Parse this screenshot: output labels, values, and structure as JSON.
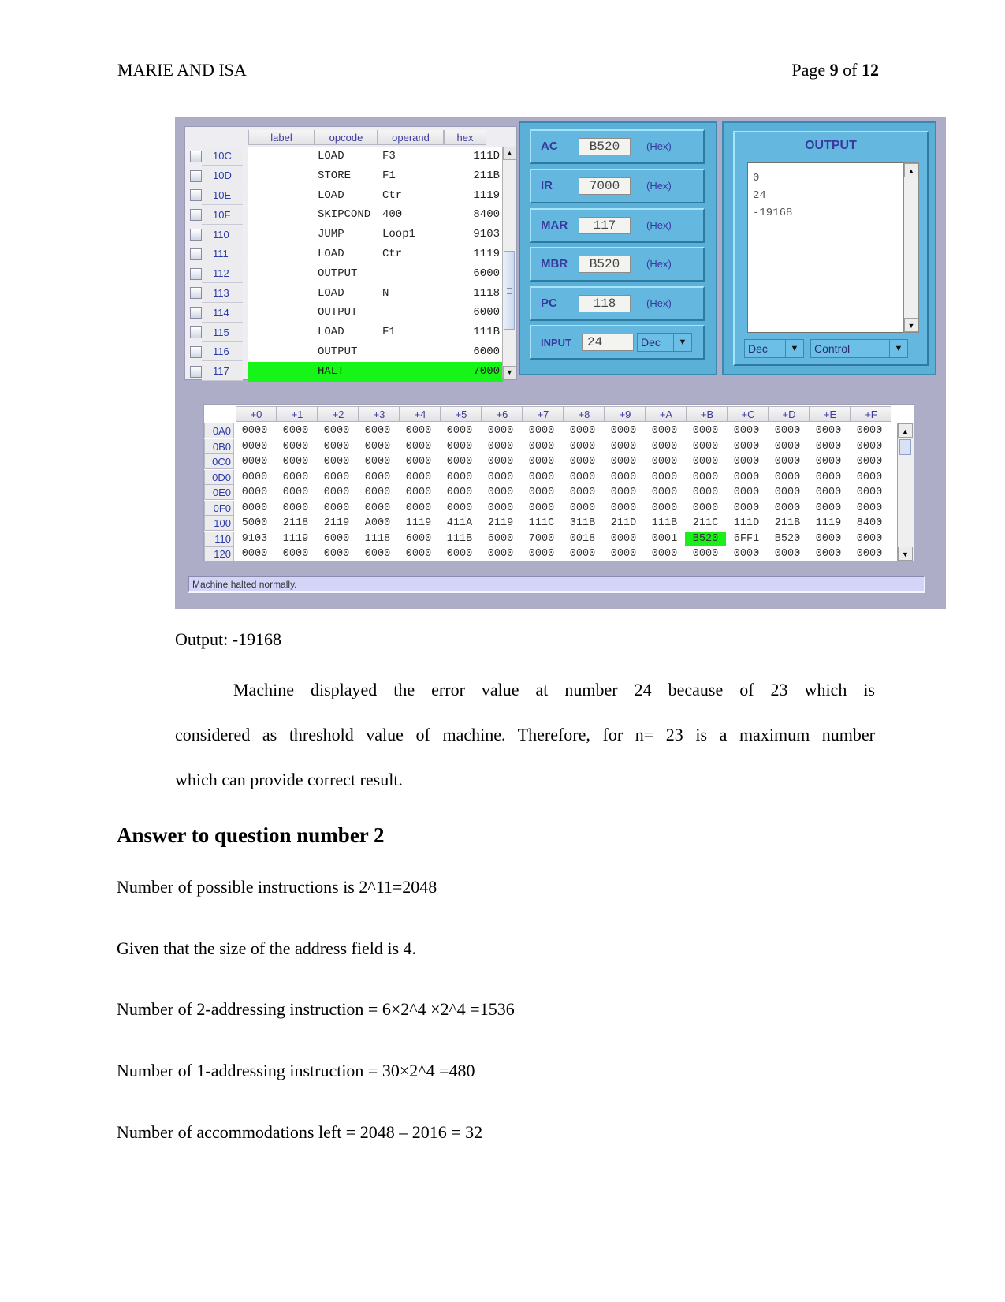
{
  "header": {
    "running_title": "MARIE AND ISA",
    "page_prefix": "Page",
    "page_number": "9",
    "page_of": "of",
    "page_total": "12"
  },
  "simulator": {
    "program_table": {
      "columns": [
        "label",
        "opcode",
        "operand",
        "hex"
      ],
      "rows": [
        {
          "addr": "10C",
          "label": "",
          "opcode": "LOAD",
          "operand": "F3",
          "hex": "111D",
          "current": false
        },
        {
          "addr": "10D",
          "label": "",
          "opcode": "STORE",
          "operand": "F1",
          "hex": "211B",
          "current": false
        },
        {
          "addr": "10E",
          "label": "",
          "opcode": "LOAD",
          "operand": "Ctr",
          "hex": "1119",
          "current": false
        },
        {
          "addr": "10F",
          "label": "",
          "opcode": "SKIPCOND",
          "operand": "400",
          "hex": "8400",
          "current": false
        },
        {
          "addr": "110",
          "label": "",
          "opcode": "JUMP",
          "operand": "Loop1",
          "hex": "9103",
          "current": false
        },
        {
          "addr": "111",
          "label": "",
          "opcode": "LOAD",
          "operand": "Ctr",
          "hex": "1119",
          "current": false
        },
        {
          "addr": "112",
          "label": "",
          "opcode": "OUTPUT",
          "operand": "",
          "hex": "6000",
          "current": false
        },
        {
          "addr": "113",
          "label": "",
          "opcode": "LOAD",
          "operand": "N",
          "hex": "1118",
          "current": false
        },
        {
          "addr": "114",
          "label": "",
          "opcode": "OUTPUT",
          "operand": "",
          "hex": "6000",
          "current": false
        },
        {
          "addr": "115",
          "label": "",
          "opcode": "LOAD",
          "operand": "F1",
          "hex": "111B",
          "current": false
        },
        {
          "addr": "116",
          "label": "",
          "opcode": "OUTPUT",
          "operand": "",
          "hex": "6000",
          "current": false
        },
        {
          "addr": "117",
          "label": "",
          "opcode": "HALT",
          "operand": "",
          "hex": "7000",
          "current": true
        }
      ]
    },
    "registers": [
      {
        "name": "AC",
        "value": "B520",
        "unit": "(Hex)"
      },
      {
        "name": "IR",
        "value": "7000",
        "unit": "(Hex)"
      },
      {
        "name": "MAR",
        "value": "117",
        "unit": "(Hex)"
      },
      {
        "name": "MBR",
        "value": "B520",
        "unit": "(Hex)"
      },
      {
        "name": "PC",
        "value": "118",
        "unit": "(Hex)"
      }
    ],
    "input": {
      "name": "INPUT",
      "value": "24",
      "mode": "Dec"
    },
    "output": {
      "title": "OUTPUT",
      "lines": [
        "0",
        "24",
        "-19168"
      ],
      "mode": "Dec",
      "control": "Control"
    },
    "memory": {
      "columns": [
        "+0",
        "+1",
        "+2",
        "+3",
        "+4",
        "+5",
        "+6",
        "+7",
        "+8",
        "+9",
        "+A",
        "+B",
        "+C",
        "+D",
        "+E",
        "+F"
      ],
      "rows": [
        {
          "addr": "0A0",
          "cells": [
            "0000",
            "0000",
            "0000",
            "0000",
            "0000",
            "0000",
            "0000",
            "0000",
            "0000",
            "0000",
            "0000",
            "0000",
            "0000",
            "0000",
            "0000",
            "0000"
          ]
        },
        {
          "addr": "0B0",
          "cells": [
            "0000",
            "0000",
            "0000",
            "0000",
            "0000",
            "0000",
            "0000",
            "0000",
            "0000",
            "0000",
            "0000",
            "0000",
            "0000",
            "0000",
            "0000",
            "0000"
          ]
        },
        {
          "addr": "0C0",
          "cells": [
            "0000",
            "0000",
            "0000",
            "0000",
            "0000",
            "0000",
            "0000",
            "0000",
            "0000",
            "0000",
            "0000",
            "0000",
            "0000",
            "0000",
            "0000",
            "0000"
          ]
        },
        {
          "addr": "0D0",
          "cells": [
            "0000",
            "0000",
            "0000",
            "0000",
            "0000",
            "0000",
            "0000",
            "0000",
            "0000",
            "0000",
            "0000",
            "0000",
            "0000",
            "0000",
            "0000",
            "0000"
          ]
        },
        {
          "addr": "0E0",
          "cells": [
            "0000",
            "0000",
            "0000",
            "0000",
            "0000",
            "0000",
            "0000",
            "0000",
            "0000",
            "0000",
            "0000",
            "0000",
            "0000",
            "0000",
            "0000",
            "0000"
          ]
        },
        {
          "addr": "0F0",
          "cells": [
            "0000",
            "0000",
            "0000",
            "0000",
            "0000",
            "0000",
            "0000",
            "0000",
            "0000",
            "0000",
            "0000",
            "0000",
            "0000",
            "0000",
            "0000",
            "0000"
          ]
        },
        {
          "addr": "100",
          "cells": [
            "5000",
            "2118",
            "2119",
            "A000",
            "1119",
            "411A",
            "2119",
            "111C",
            "311B",
            "211D",
            "111B",
            "211C",
            "111D",
            "211B",
            "1119",
            "8400"
          ]
        },
        {
          "addr": "110",
          "cells": [
            "9103",
            "1119",
            "6000",
            "1118",
            "6000",
            "111B",
            "6000",
            "7000",
            "0018",
            "0000",
            "0001",
            "B520",
            "6FF1",
            "B520",
            "0000",
            "0000"
          ]
        },
        {
          "addr": "120",
          "cells": [
            "0000",
            "0000",
            "0000",
            "0000",
            "0000",
            "0000",
            "0000",
            "0000",
            "0000",
            "0000",
            "0000",
            "0000",
            "0000",
            "0000",
            "0000",
            "0000"
          ]
        }
      ],
      "highlight": {
        "row": "110",
        "col": "+B"
      }
    },
    "status": "Machine halted normally."
  },
  "body": {
    "output_line": "Output: -19168",
    "paragraph_line1": "Machine displayed the error value at number 24 because of 23 which is",
    "paragraph_line2": "considered as threshold value of machine. Therefore, for n= 23 is a maximum number",
    "paragraph_line3": "which can provide correct result.",
    "heading": "Answer to question number 2",
    "lines": [
      "Number of possible instructions is 2^11=2048",
      "Given that the size of the address field is 4.",
      "Number of 2-addressing instruction = 6×2^4 ×2^4 =1536",
      "Number of 1-addressing instruction = 30×2^4 =480",
      "Number of accommodations left = 2048 – 2016 = 32"
    ]
  }
}
